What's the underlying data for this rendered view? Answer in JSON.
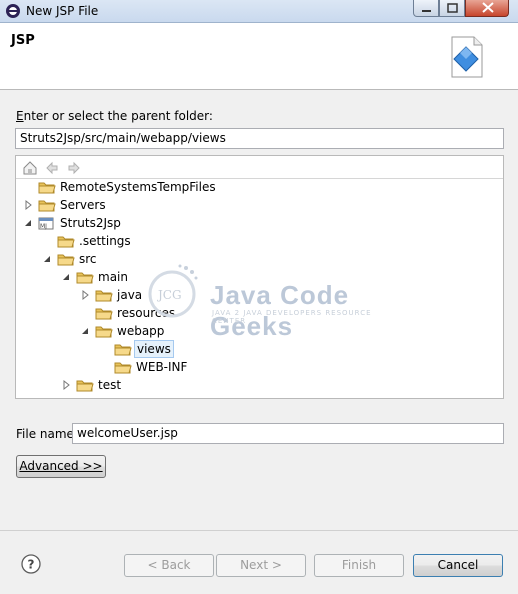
{
  "window": {
    "title": "New JSP File"
  },
  "banner": {
    "title": "JSP"
  },
  "parent_folder": {
    "label_mnemonic": "E",
    "label_rest": "nter or select the parent folder:",
    "value": "Struts2Jsp/src/main/webapp/views"
  },
  "tree": {
    "nodes": [
      {
        "label": "RemoteSystemsTempFiles",
        "icon": "folder-open-icon",
        "expander": "none",
        "depth": 0
      },
      {
        "label": "Servers",
        "icon": "folder-open-icon",
        "expander": "collapsed",
        "depth": 0
      },
      {
        "label": "Struts2Jsp",
        "icon": "project-icon",
        "expander": "expanded",
        "depth": 0
      },
      {
        "label": ".settings",
        "icon": "folder-icon",
        "expander": "none",
        "depth": 1
      },
      {
        "label": "src",
        "icon": "folder-icon",
        "expander": "expanded",
        "depth": 1
      },
      {
        "label": "main",
        "icon": "folder-icon",
        "expander": "expanded",
        "depth": 2
      },
      {
        "label": "java",
        "icon": "folder-icon",
        "expander": "collapsed",
        "depth": 3
      },
      {
        "label": "resources",
        "icon": "folder-icon",
        "expander": "none",
        "depth": 3
      },
      {
        "label": "webapp",
        "icon": "folder-icon",
        "expander": "expanded",
        "depth": 3
      },
      {
        "label": "views",
        "icon": "folder-icon",
        "expander": "none",
        "depth": 4,
        "selected": true
      },
      {
        "label": "WEB-INF",
        "icon": "folder-icon",
        "expander": "none",
        "depth": 4
      },
      {
        "label": "test",
        "icon": "folder-icon",
        "expander": "collapsed",
        "depth": 2
      }
    ]
  },
  "watermark": {
    "logo_text": "JCG",
    "title": "Java Code Geeks",
    "subtitle": "JAVA 2 JAVA DEVELOPERS RESOURCE CENTER"
  },
  "file_name": {
    "label": "File name:",
    "value": "welcomeUser.jsp"
  },
  "buttons": {
    "advanced": "Advanced >>",
    "back": "< Back",
    "next": "Next >",
    "finish": "Finish",
    "cancel": "Cancel"
  },
  "colors": {
    "selection": "#e5f1fb",
    "folder": "#e8c35a"
  }
}
